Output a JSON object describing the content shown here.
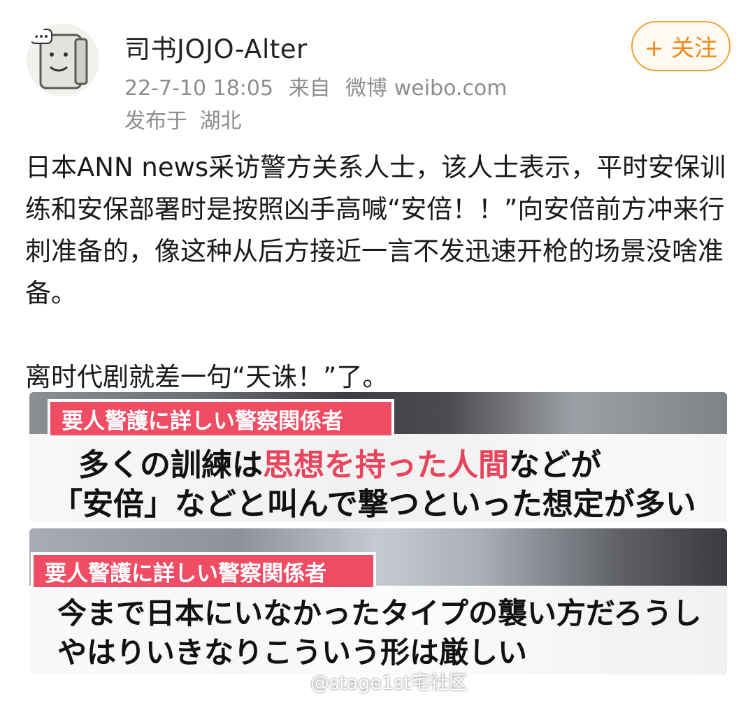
{
  "post": {
    "author": {
      "name": "司书JOJO-Alter",
      "avatar_icon": "cartoon-face-avatar"
    },
    "meta": {
      "time": "22-7-10 18:05",
      "source_prefix": "来自",
      "source": "微博 weibo.com",
      "location_prefix": "发布于",
      "location": "湖北"
    },
    "follow_button": "+ 关注",
    "text": {
      "paragraph1": "日本ANN news采访警方关系人士，该人士表示，平时安保训练和安保部署时是按照凶手高喊“安倍！！”向安倍前方冲来行刺准备的，像这种从后方接近一言不发迅速开枪的场景没啥准备。",
      "paragraph2": "离时代剧就差一句“天诛！”了。"
    },
    "images": [
      {
        "tag": "要人警護に詳しい警察関係者",
        "line1_a": "多くの訓練は",
        "line1_highlight": "思想を持った人間",
        "line1_b": "などが",
        "line2": "「安倍」などと叫んで撃つといった想定が多い"
      },
      {
        "tag": "要人警護に詳しい警察関係者",
        "line1": "今まで日本にいなかったタイプの襲い方だろうし",
        "line2": "やはりいきなりこういう形は厳しい"
      }
    ],
    "watermark": "@stage1st宅社区",
    "colors": {
      "accent_orange": "#f08a1c",
      "caption_tag_red": "#ee4d64",
      "highlight_red": "#e8455c",
      "meta_gray": "#8d8d8d"
    }
  }
}
